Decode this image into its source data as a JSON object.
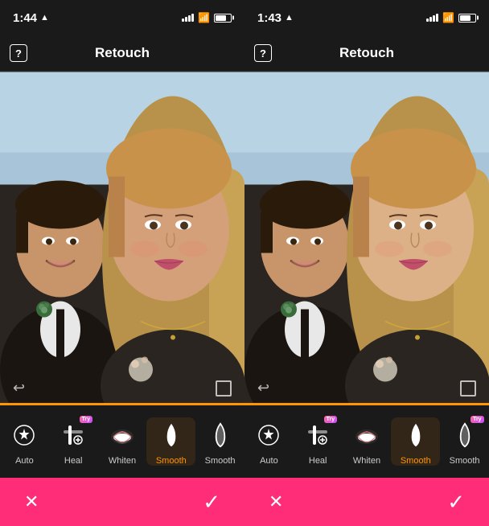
{
  "panels": [
    {
      "id": "left",
      "statusBar": {
        "time": "1:44",
        "locationIcon": true,
        "wifi": true,
        "battery": true
      },
      "navBar": {
        "helpLabel": "?",
        "title": "Retouch"
      },
      "tools": [
        {
          "id": "auto",
          "label": "Auto",
          "hasTry": false,
          "icon": "auto"
        },
        {
          "id": "heal",
          "label": "Heal",
          "hasTry": true,
          "icon": "heal"
        },
        {
          "id": "whiten",
          "label": "Whiten",
          "hasTry": false,
          "icon": "lips"
        },
        {
          "id": "smooth",
          "label": "Smooth",
          "hasTry": false,
          "icon": "drop",
          "active": true
        },
        {
          "id": "smooth2",
          "label": "Smooth",
          "hasTry": false,
          "icon": "drop2"
        }
      ],
      "actionBar": {
        "cancelLabel": "✕",
        "confirmLabel": "✓"
      },
      "undoIcon": "↩",
      "cropFrameVisible": true
    },
    {
      "id": "right",
      "statusBar": {
        "time": "1:43",
        "locationIcon": true,
        "wifi": true,
        "battery": true
      },
      "navBar": {
        "helpLabel": "?",
        "title": "Retouch"
      },
      "tools": [
        {
          "id": "auto",
          "label": "Auto",
          "hasTry": false,
          "icon": "auto"
        },
        {
          "id": "heal",
          "label": "Heal",
          "hasTry": true,
          "icon": "heal"
        },
        {
          "id": "whiten",
          "label": "Whiten",
          "hasTry": false,
          "icon": "lips"
        },
        {
          "id": "smooth",
          "label": "Smooth",
          "hasTry": false,
          "icon": "drop",
          "active": true
        },
        {
          "id": "smooth2",
          "label": "Smooth",
          "hasTry": true,
          "icon": "drop2"
        }
      ],
      "actionBar": {
        "cancelLabel": "✕",
        "confirmLabel": "✓"
      },
      "undoIcon": "↩",
      "cropFrameVisible": true
    }
  ],
  "colors": {
    "accent": "#FF9500",
    "actionBar": "#FF2D78",
    "background": "#1a1a1a",
    "tryBadge": "#c44dff"
  }
}
